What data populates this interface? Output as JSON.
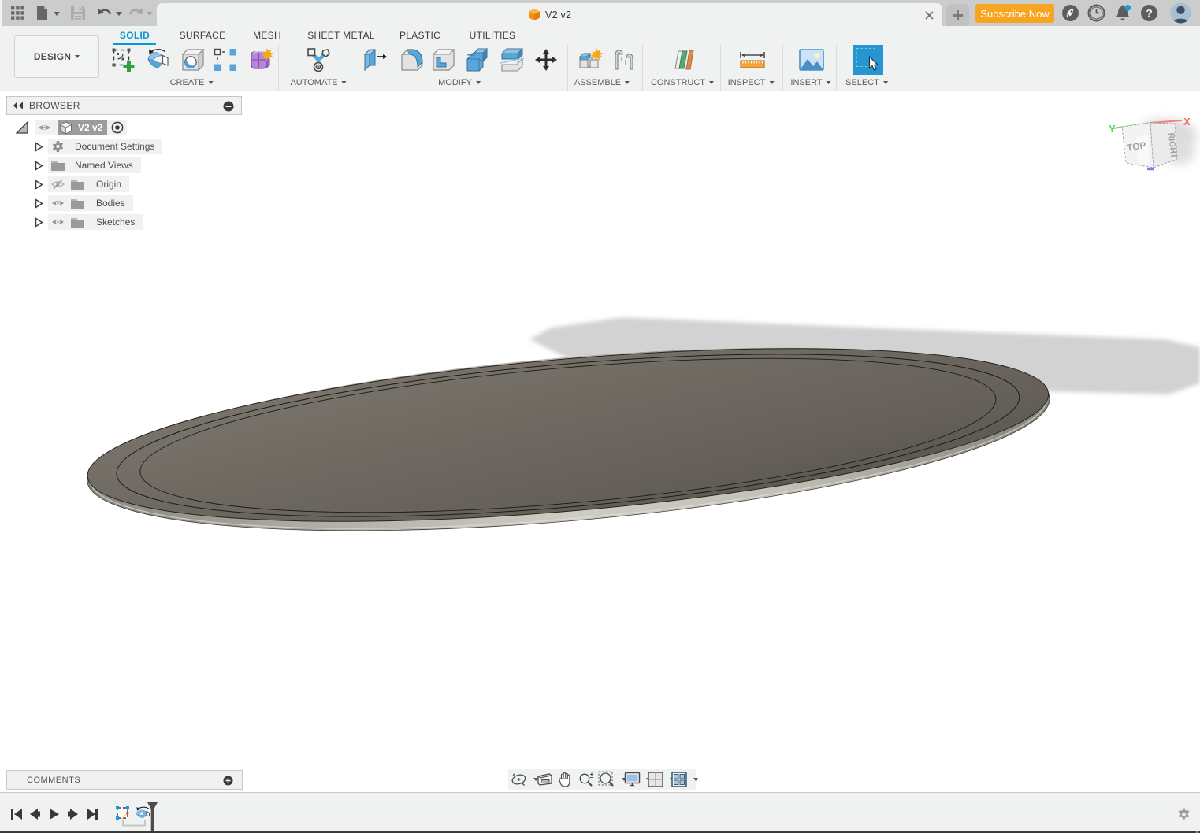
{
  "colors": {
    "accent_blue": "#0a96d4",
    "orange": "#f7a521",
    "ribbon_bg": "#f0f1f1",
    "titlebar_bg": "#cbcccc"
  },
  "titlebar": {
    "tab_title": "V2 v2",
    "subscribe_label": "Subscribe Now",
    "help_glyph": "?"
  },
  "ribbon": {
    "design_label": "DESIGN",
    "tabs": [
      {
        "label": "SOLID",
        "active": true
      },
      {
        "label": "SURFACE"
      },
      {
        "label": "MESH"
      },
      {
        "label": "SHEET METAL"
      },
      {
        "label": "PLASTIC"
      },
      {
        "label": "UTILITIES"
      }
    ],
    "groups": [
      {
        "label": "CREATE"
      },
      {
        "label": "AUTOMATE"
      },
      {
        "label": "MODIFY"
      },
      {
        "label": "ASSEMBLE"
      },
      {
        "label": "CONSTRUCT"
      },
      {
        "label": "INSPECT"
      },
      {
        "label": "INSERT"
      },
      {
        "label": "SELECT"
      }
    ]
  },
  "browser": {
    "title": "BROWSER",
    "root_label": "V2 v2",
    "items": [
      {
        "label": "Document Settings"
      },
      {
        "label": "Named Views"
      },
      {
        "label": "Origin",
        "hidden": true
      },
      {
        "label": "Bodies"
      },
      {
        "label": "Sketches"
      }
    ]
  },
  "viewcube": {
    "top_label": "TOP",
    "right_label": "RIGHT",
    "axis_x": "X",
    "axis_y": "Y"
  },
  "comments": {
    "title": "COMMENTS"
  }
}
